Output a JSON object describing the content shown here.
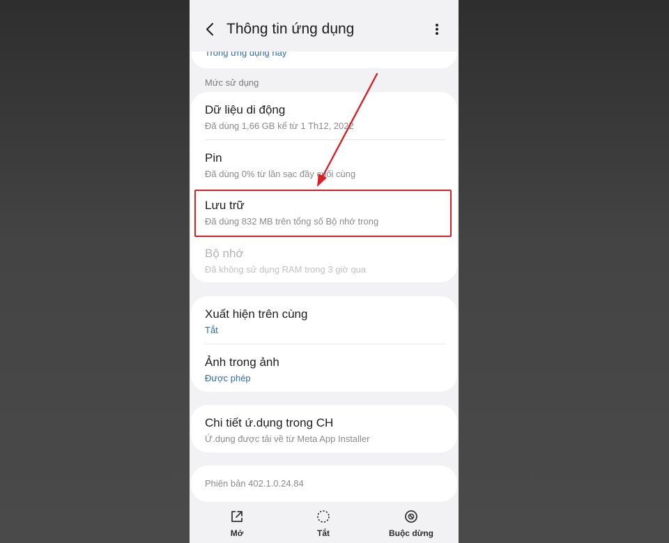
{
  "header": {
    "title": "Thông tin ứng dụng"
  },
  "top_card": {
    "link_text": "Trong ứng dụng này"
  },
  "usage_section": {
    "label": "Mức sử dụng",
    "items": [
      {
        "title": "Dữ liệu di động",
        "subtitle": "Đã dùng 1,66 GB kể từ 1 Th12, 2022"
      },
      {
        "title": "Pin",
        "subtitle": "Đã dùng 0% từ lần sạc đầy cuối cùng"
      },
      {
        "title": "Lưu trữ",
        "subtitle": "Đã dùng 832 MB trên tổng số Bộ nhớ trong"
      },
      {
        "title": "Bộ nhớ",
        "subtitle": "Đã không sử dụng RAM trong 3 giờ qua"
      }
    ]
  },
  "overlay_section": {
    "items": [
      {
        "title": "Xuất hiện trên cùng",
        "subtitle": "Tắt"
      },
      {
        "title": "Ảnh trong ảnh",
        "subtitle": "Được phép"
      }
    ]
  },
  "store_section": {
    "title": "Chi tiết ứ.dụng trong CH",
    "subtitle": "Ứ.dụng được tải về từ Meta App Installer"
  },
  "version": "Phiên bản 402.1.0.24.84",
  "bottom_bar": {
    "open_label": "Mở",
    "disable_label": "Tắt",
    "force_stop_label": "Buộc dừng"
  },
  "colors": {
    "highlight": "#d91f26",
    "link": "#2a6db0",
    "arrow": "#d91f26"
  }
}
